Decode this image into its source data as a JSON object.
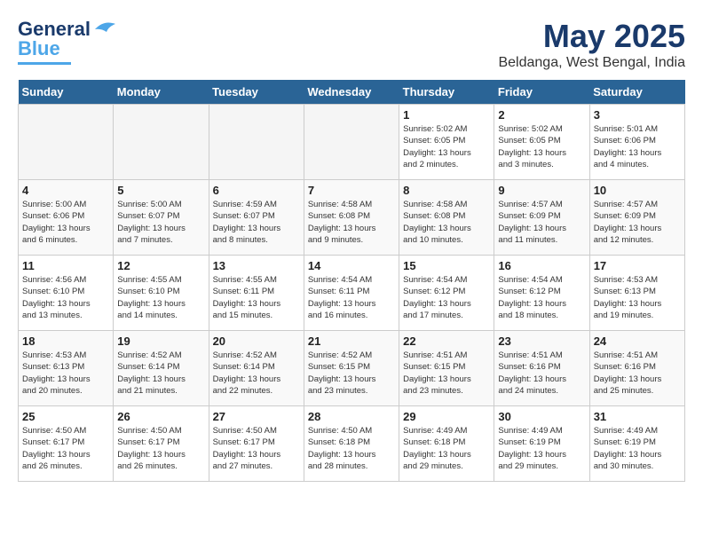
{
  "logo": {
    "line1": "General",
    "line2": "Blue"
  },
  "title": "May 2025",
  "subtitle": "Beldanga, West Bengal, India",
  "days_of_week": [
    "Sunday",
    "Monday",
    "Tuesday",
    "Wednesday",
    "Thursday",
    "Friday",
    "Saturday"
  ],
  "weeks": [
    [
      {
        "num": "",
        "info": ""
      },
      {
        "num": "",
        "info": ""
      },
      {
        "num": "",
        "info": ""
      },
      {
        "num": "",
        "info": ""
      },
      {
        "num": "1",
        "info": "Sunrise: 5:02 AM\nSunset: 6:05 PM\nDaylight: 13 hours\nand 2 minutes."
      },
      {
        "num": "2",
        "info": "Sunrise: 5:02 AM\nSunset: 6:05 PM\nDaylight: 13 hours\nand 3 minutes."
      },
      {
        "num": "3",
        "info": "Sunrise: 5:01 AM\nSunset: 6:06 PM\nDaylight: 13 hours\nand 4 minutes."
      }
    ],
    [
      {
        "num": "4",
        "info": "Sunrise: 5:00 AM\nSunset: 6:06 PM\nDaylight: 13 hours\nand 6 minutes."
      },
      {
        "num": "5",
        "info": "Sunrise: 5:00 AM\nSunset: 6:07 PM\nDaylight: 13 hours\nand 7 minutes."
      },
      {
        "num": "6",
        "info": "Sunrise: 4:59 AM\nSunset: 6:07 PM\nDaylight: 13 hours\nand 8 minutes."
      },
      {
        "num": "7",
        "info": "Sunrise: 4:58 AM\nSunset: 6:08 PM\nDaylight: 13 hours\nand 9 minutes."
      },
      {
        "num": "8",
        "info": "Sunrise: 4:58 AM\nSunset: 6:08 PM\nDaylight: 13 hours\nand 10 minutes."
      },
      {
        "num": "9",
        "info": "Sunrise: 4:57 AM\nSunset: 6:09 PM\nDaylight: 13 hours\nand 11 minutes."
      },
      {
        "num": "10",
        "info": "Sunrise: 4:57 AM\nSunset: 6:09 PM\nDaylight: 13 hours\nand 12 minutes."
      }
    ],
    [
      {
        "num": "11",
        "info": "Sunrise: 4:56 AM\nSunset: 6:10 PM\nDaylight: 13 hours\nand 13 minutes."
      },
      {
        "num": "12",
        "info": "Sunrise: 4:55 AM\nSunset: 6:10 PM\nDaylight: 13 hours\nand 14 minutes."
      },
      {
        "num": "13",
        "info": "Sunrise: 4:55 AM\nSunset: 6:11 PM\nDaylight: 13 hours\nand 15 minutes."
      },
      {
        "num": "14",
        "info": "Sunrise: 4:54 AM\nSunset: 6:11 PM\nDaylight: 13 hours\nand 16 minutes."
      },
      {
        "num": "15",
        "info": "Sunrise: 4:54 AM\nSunset: 6:12 PM\nDaylight: 13 hours\nand 17 minutes."
      },
      {
        "num": "16",
        "info": "Sunrise: 4:54 AM\nSunset: 6:12 PM\nDaylight: 13 hours\nand 18 minutes."
      },
      {
        "num": "17",
        "info": "Sunrise: 4:53 AM\nSunset: 6:13 PM\nDaylight: 13 hours\nand 19 minutes."
      }
    ],
    [
      {
        "num": "18",
        "info": "Sunrise: 4:53 AM\nSunset: 6:13 PM\nDaylight: 13 hours\nand 20 minutes."
      },
      {
        "num": "19",
        "info": "Sunrise: 4:52 AM\nSunset: 6:14 PM\nDaylight: 13 hours\nand 21 minutes."
      },
      {
        "num": "20",
        "info": "Sunrise: 4:52 AM\nSunset: 6:14 PM\nDaylight: 13 hours\nand 22 minutes."
      },
      {
        "num": "21",
        "info": "Sunrise: 4:52 AM\nSunset: 6:15 PM\nDaylight: 13 hours\nand 23 minutes."
      },
      {
        "num": "22",
        "info": "Sunrise: 4:51 AM\nSunset: 6:15 PM\nDaylight: 13 hours\nand 23 minutes."
      },
      {
        "num": "23",
        "info": "Sunrise: 4:51 AM\nSunset: 6:16 PM\nDaylight: 13 hours\nand 24 minutes."
      },
      {
        "num": "24",
        "info": "Sunrise: 4:51 AM\nSunset: 6:16 PM\nDaylight: 13 hours\nand 25 minutes."
      }
    ],
    [
      {
        "num": "25",
        "info": "Sunrise: 4:50 AM\nSunset: 6:17 PM\nDaylight: 13 hours\nand 26 minutes."
      },
      {
        "num": "26",
        "info": "Sunrise: 4:50 AM\nSunset: 6:17 PM\nDaylight: 13 hours\nand 26 minutes."
      },
      {
        "num": "27",
        "info": "Sunrise: 4:50 AM\nSunset: 6:17 PM\nDaylight: 13 hours\nand 27 minutes."
      },
      {
        "num": "28",
        "info": "Sunrise: 4:50 AM\nSunset: 6:18 PM\nDaylight: 13 hours\nand 28 minutes."
      },
      {
        "num": "29",
        "info": "Sunrise: 4:49 AM\nSunset: 6:18 PM\nDaylight: 13 hours\nand 29 minutes."
      },
      {
        "num": "30",
        "info": "Sunrise: 4:49 AM\nSunset: 6:19 PM\nDaylight: 13 hours\nand 29 minutes."
      },
      {
        "num": "31",
        "info": "Sunrise: 4:49 AM\nSunset: 6:19 PM\nDaylight: 13 hours\nand 30 minutes."
      }
    ]
  ]
}
